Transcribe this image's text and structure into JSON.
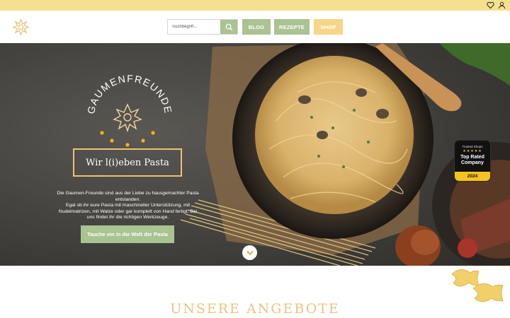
{
  "topbar": {
    "icons": [
      "heart-icon",
      "user-icon"
    ]
  },
  "header": {
    "search": {
      "placeholder": "Suchbegriff...",
      "icon": "search-icon"
    },
    "nav": [
      {
        "label": "BLOG"
      },
      {
        "label": "REZEPTE"
      },
      {
        "label": "SHOP"
      }
    ]
  },
  "hero": {
    "brand": "GAUMENFREUNDE",
    "tagline": "Wir l(i)eben Pasta",
    "text_lines": [
      "Die Gaumen-Freunde sind aus der Liebe zu hausgemachter Pasta entstanden.",
      "Egal ob ihr eure Pasta mit maschineller Unterstützung, mit Nudelmatrizen, mit Walze oder gar komplett von Hand fertigt: Bei uns findet ihr die richtigen Werkzeuge."
    ],
    "cta": "Tauche ein in die Welt der Pasta",
    "badge": {
      "line1": "Trusted Shops",
      "stars": "★★★★★",
      "line2": "Top Rated Company",
      "year": "2024"
    }
  },
  "section": {
    "title": "UNSERE ANGEBOTE"
  },
  "colors": {
    "accent_green": "#a9c391",
    "accent_yellow": "#f6d68b",
    "topbar": "#f6e08f",
    "gold": "#e8c27c"
  }
}
